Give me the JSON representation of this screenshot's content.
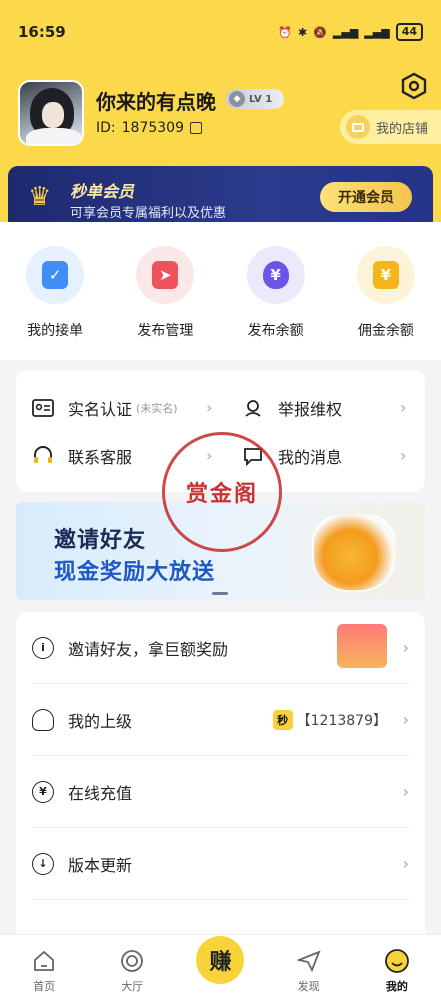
{
  "status_bar": {
    "time": "16:59",
    "battery": "44"
  },
  "profile": {
    "username": "你来的有点晚",
    "level": "LV 1",
    "id_label": "ID:",
    "id_value": "1875309",
    "shop_label": "我的店铺"
  },
  "vip": {
    "title": "秒单会员",
    "subtitle": "可享会员专属福利以及优惠",
    "button": "开通会员"
  },
  "quick_actions": [
    {
      "label": "我的接单",
      "icon": "clipboard-check-icon",
      "color": "#3f8ef7",
      "bg": "#e6f0fe"
    },
    {
      "label": "发布管理",
      "icon": "paper-plane-icon",
      "color": "#f0525b",
      "bg": "#fde8e9"
    },
    {
      "label": "发布余额",
      "icon": "money-bag-icon",
      "color": "#6a55e8",
      "bg": "#ece9fd"
    },
    {
      "label": "佣金余额",
      "icon": "yen-ticket-icon",
      "color": "#f3b51a",
      "bg": "#fdf3d9"
    }
  ],
  "menu": {
    "real_name": "实名认证",
    "real_name_note": "(未实名)",
    "report": "举报维权",
    "support": "联系客服",
    "messages": "我的消息"
  },
  "stamp_text": "赏金阁",
  "promo": {
    "line1": "邀请好友",
    "line2": "现金奖励大放送"
  },
  "list": {
    "invite": "邀请好友，拿巨额奖励",
    "superior": "我的上级",
    "superior_badge": "秒",
    "superior_value": "【1213879】",
    "recharge": "在线充值",
    "update": "版本更新"
  },
  "bottom_nav": {
    "home": "首页",
    "hall": "大厅",
    "earn": "赚",
    "discover": "发现",
    "mine": "我的"
  }
}
